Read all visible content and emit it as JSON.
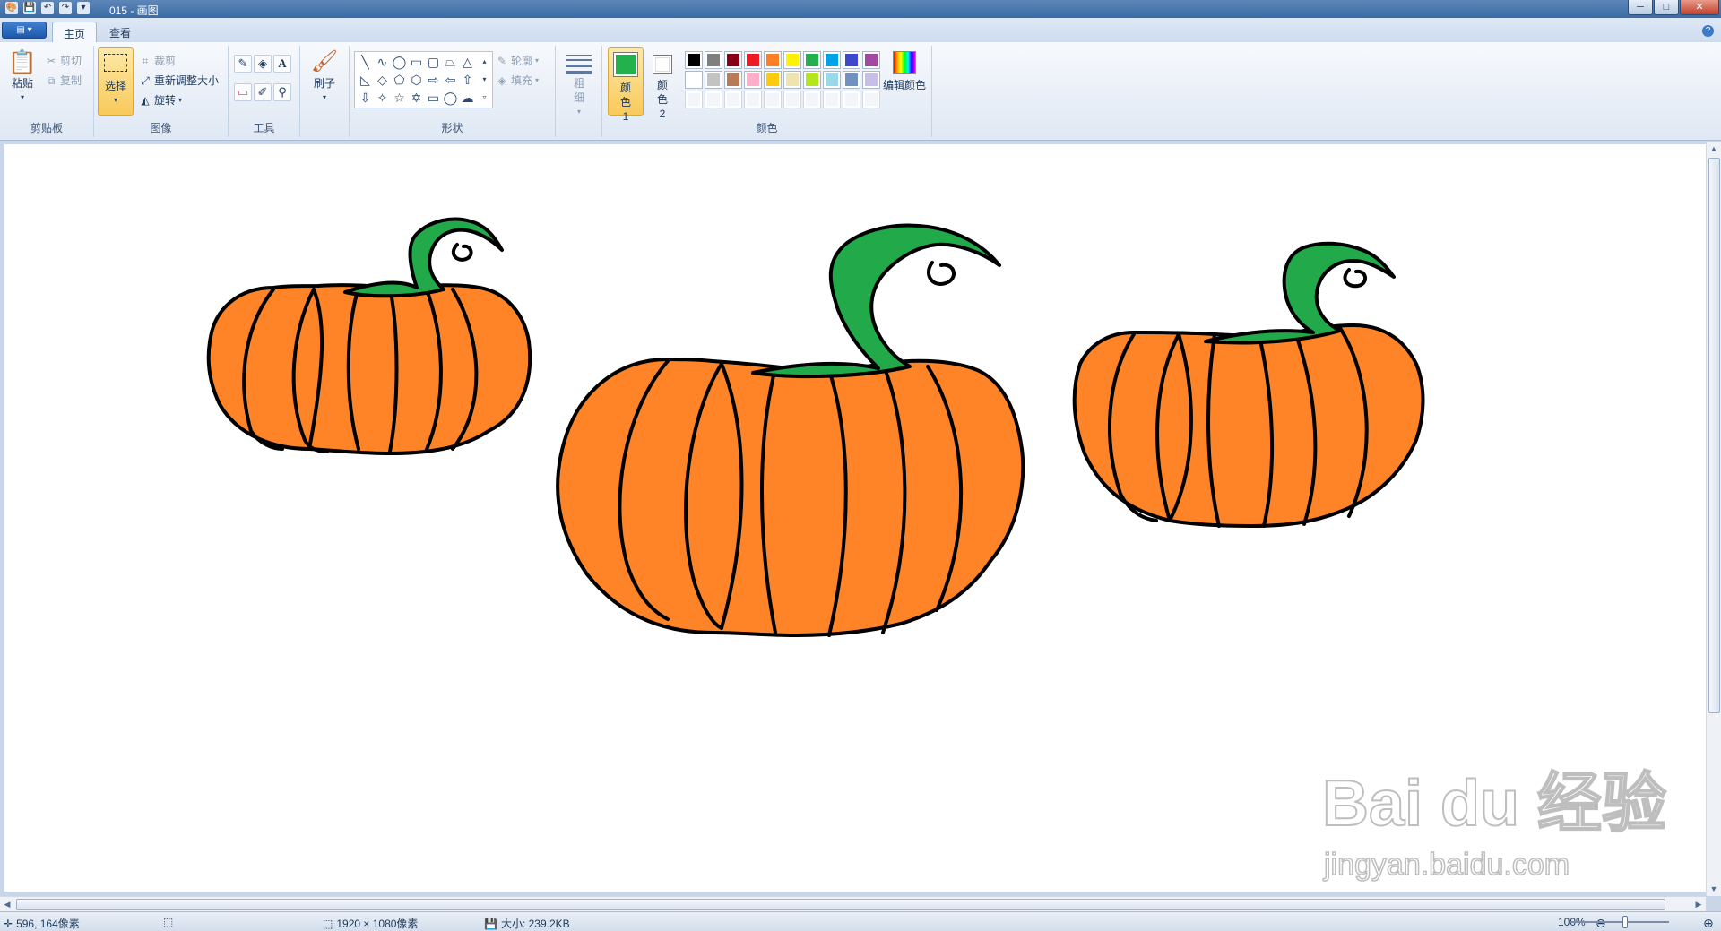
{
  "window": {
    "title": "015 - 画图",
    "minimize": "─",
    "maximize": "□",
    "close": "✕"
  },
  "quick_access": [
    "💾",
    "↶",
    "↷",
    "▾"
  ],
  "menu": {
    "file_button": "▤ ▾",
    "tabs": [
      "主页",
      "查看"
    ],
    "help": "?"
  },
  "ribbon": {
    "clipboard": {
      "label": "剪贴板",
      "paste": "粘贴",
      "cut": "剪切",
      "copy": "复制"
    },
    "image": {
      "label": "图像",
      "select": "选择",
      "crop": "裁剪",
      "resize": "重新调整大小",
      "rotate": "旋转"
    },
    "tools": {
      "label": "工具"
    },
    "brushes": {
      "label": "刷子"
    },
    "shapes": {
      "label": "形状",
      "outline": "轮廓",
      "fill": "填充"
    },
    "size": {
      "label": "粗细"
    },
    "colors": {
      "label": "颜色",
      "color1": "颜色 1",
      "color2": "颜色 2",
      "edit": "编辑颜色",
      "color1_value": "#22b14c",
      "color2_value": "#ffffff",
      "palette_row1": [
        "#000000",
        "#7f7f7f",
        "#880015",
        "#ed1c24",
        "#ff7f27",
        "#fff200",
        "#22b14c",
        "#00a2e8",
        "#3f48cc",
        "#a349a4"
      ],
      "palette_row2": [
        "#ffffff",
        "#c3c3c3",
        "#b97a57",
        "#ffaec9",
        "#ffc90e",
        "#efe4b0",
        "#b5e61d",
        "#99d9ea",
        "#7092be",
        "#c8bfe7"
      ]
    }
  },
  "statusbar": {
    "cursor_pos": "596, 164像素",
    "image_size": "1920 × 1080像素",
    "file_size": "大小: 239.2KB",
    "zoom": "100%"
  },
  "watermark": {
    "brand": "Bai du 经验",
    "url": "jingyan.baidu.com"
  },
  "colors": {
    "pumpkin": "#fe8427",
    "stem": "#22a94a",
    "outline": "#000000"
  }
}
